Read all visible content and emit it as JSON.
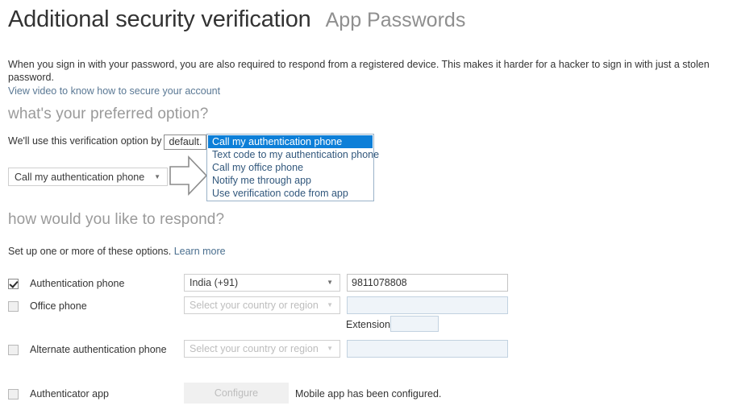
{
  "header": {
    "title": "Additional security verification",
    "app_passwords_link": "App Passwords"
  },
  "intro": {
    "text": "When you sign in with your password, you are also required to respond from a registered device. This makes it harder for a hacker to sign in with just a stolen password.",
    "link": "View video to know how to secure your account"
  },
  "preferred": {
    "heading": "what's your preferred option?",
    "sentence_prefix": "We'll use this verification option by",
    "annotated_word": "default.",
    "selected_value": "Call my authentication phone",
    "caret_glyph": "▼",
    "options": [
      "Call my authentication phone",
      "Text code to my authentication phone",
      "Call my office phone",
      "Notify me through app",
      "Use verification code from app"
    ],
    "selected_index": 0,
    "highlight_color": "#0d7fd8"
  },
  "respond": {
    "heading": "how would you like to respond?",
    "setup_text": "Set up one or more of these options.",
    "learn_more": "Learn more",
    "country_placeholder": "Select your country or region",
    "extension_label": "Extension",
    "rows": [
      {
        "label": "Authentication phone",
        "checked": true,
        "country": "India (+91)",
        "phone": "9811078808"
      },
      {
        "label": "Office phone",
        "checked": false,
        "country": "",
        "phone": ""
      },
      {
        "label": "Alternate authentication phone",
        "checked": false,
        "country": "",
        "phone": ""
      }
    ],
    "extension_value": "",
    "authenticator": {
      "label": "Authenticator app",
      "checked": false,
      "configure_label": "Configure",
      "status": "Mobile app has been configured."
    }
  }
}
